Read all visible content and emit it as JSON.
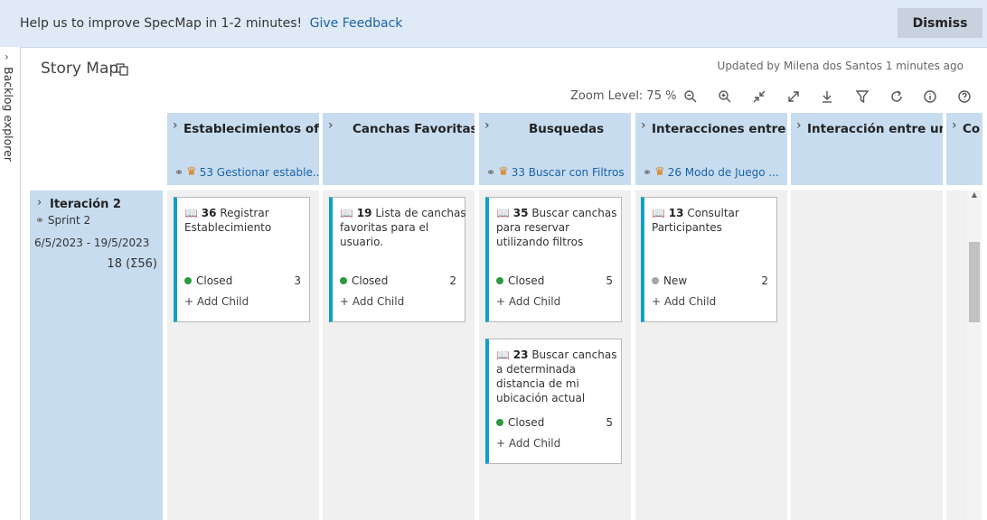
{
  "banner": {
    "message": "Help us to improve SpecMap in 1-2 minutes!",
    "link": "Give Feedback",
    "dismiss": "Dismiss"
  },
  "sidebar": {
    "label": "Backlog explorer"
  },
  "header": {
    "title": "Story Map",
    "updated": "Updated by Milena dos Santos 1 minutes ago",
    "zoom": "Zoom Level: 75 %",
    "toolbar_icons": [
      "zoom-out-icon",
      "zoom-in-icon",
      "collapse-icon",
      "expand-icon",
      "download-icon",
      "filter-icon",
      "refresh-icon",
      "info-icon",
      "help-icon"
    ]
  },
  "columns": [
    {
      "title": "Establecimientos ofr...",
      "link": "53 Gestionar estable..."
    },
    {
      "title": "Canchas Favoritas",
      "link": ""
    },
    {
      "title": "Busquedas",
      "link": "33 Buscar con Filtros"
    },
    {
      "title": "Interacciones entre ...",
      "link": "26 Modo de Juego ..."
    },
    {
      "title": "Interacción entre un...",
      "link": ""
    },
    {
      "title": "Co",
      "link": ""
    }
  ],
  "iteration": {
    "name": "Iteración 2",
    "sprint": "Sprint 2",
    "dates": "6/5/2023 - 19/5/2023",
    "count": "18 (Σ56)"
  },
  "cards": [
    {
      "id": "36",
      "title": "Registrar Establecimiento",
      "state": "Closed",
      "points": "3",
      "add": "Add Child"
    },
    {
      "id": "19",
      "title": "Lista de canchas favoritas para el usuario.",
      "state": "Closed",
      "points": "2",
      "add": "Add Child"
    },
    {
      "id": "35",
      "title": "Buscar canchas para reservar utilizando filtros",
      "state": "Closed",
      "points": "5",
      "add": "Add Child"
    },
    {
      "id": "23",
      "title": "Buscar canchas a determinada distancia de mi ubicación actual",
      "state": "Closed",
      "points": "5",
      "add": "Add Child"
    },
    {
      "id": "13",
      "title": "Consultar Participantes",
      "state": "New",
      "points": "2",
      "add": "Add Child"
    }
  ],
  "colors": {
    "closed": "#2e9a3e",
    "new": "#a6a6a6",
    "accent": "#0f9fc8",
    "header": "#c7dcef"
  }
}
